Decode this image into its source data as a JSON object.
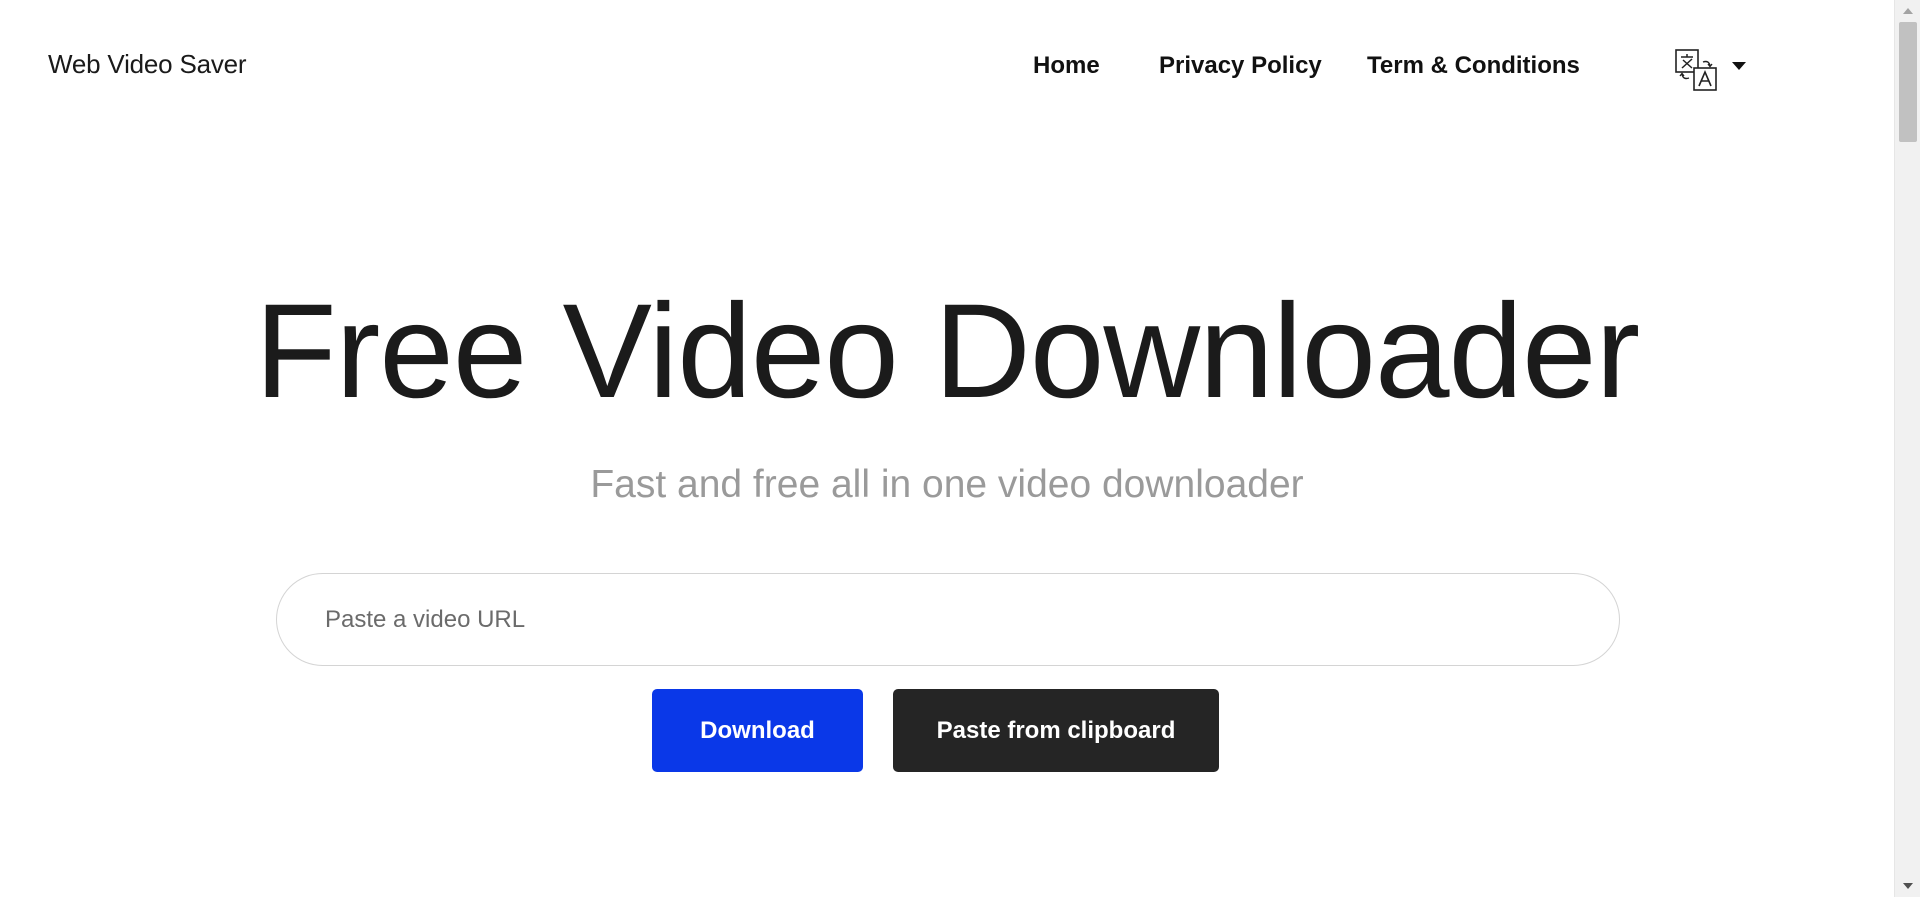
{
  "header": {
    "brand": "Web Video Saver",
    "nav": [
      {
        "label": "Home"
      },
      {
        "label": "Privacy Policy"
      },
      {
        "label": "Term & Conditions"
      }
    ],
    "language_icon": "translate-icon",
    "language_caret_icon": "caret-down-icon"
  },
  "hero": {
    "title": "Free Video Downloader",
    "subtitle": "Fast and free all in one video downloader"
  },
  "form": {
    "url_value": "",
    "url_placeholder": "Paste a video URL",
    "download_label": "Download",
    "paste_label": "Paste from clipboard"
  },
  "colors": {
    "download_button": "#0a38e8",
    "paste_button": "#252525",
    "subtitle": "#9a9a9a"
  }
}
